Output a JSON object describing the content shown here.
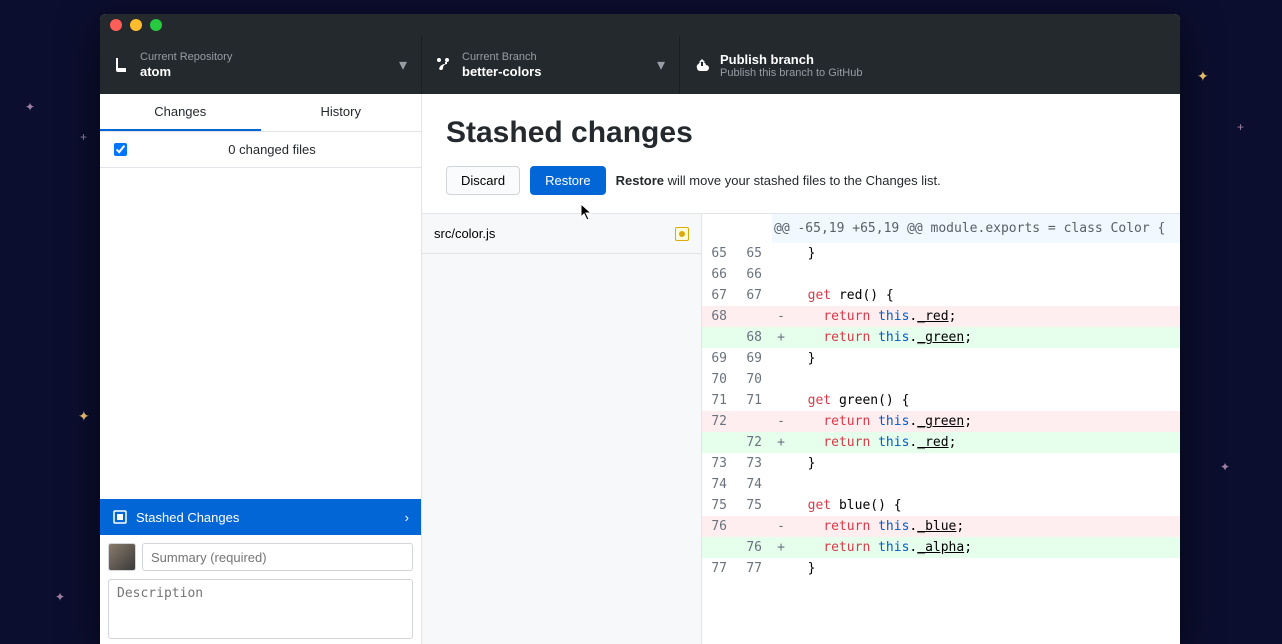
{
  "window": {
    "repo_label": "Current Repository",
    "repo_value": "atom",
    "branch_label": "Current Branch",
    "branch_value": "better-colors",
    "publish_title": "Publish branch",
    "publish_sub": "Publish this branch to GitHub"
  },
  "sidebar": {
    "tabs": {
      "changes": "Changes",
      "history": "History"
    },
    "changes_count": "0 changed files",
    "stashed_label": "Stashed Changes",
    "summary_placeholder": "Summary (required)",
    "description_placeholder": "Description"
  },
  "content": {
    "title": "Stashed changes",
    "discard": "Discard",
    "restore": "Restore",
    "hint_bold": "Restore",
    "hint_rest": " will move your stashed files to the Changes list.",
    "file": "src/color.js",
    "hunk_header": "@@ -65,19 +65,19 @@ module.exports = class Color {"
  },
  "diff": [
    {
      "old": "65",
      "new": "65",
      "type": "ctx",
      "marker": " ",
      "text": "  }"
    },
    {
      "old": "66",
      "new": "66",
      "type": "ctx",
      "marker": " ",
      "text": ""
    },
    {
      "old": "67",
      "new": "67",
      "type": "ctx",
      "marker": " ",
      "text": "  get red() {"
    },
    {
      "old": "68",
      "new": "",
      "type": "del",
      "marker": "-",
      "text": "    return this._red;",
      "uword": "red"
    },
    {
      "old": "",
      "new": "68",
      "type": "add",
      "marker": "+",
      "text": "    return this._green;",
      "uword": "green"
    },
    {
      "old": "69",
      "new": "69",
      "type": "ctx",
      "marker": " ",
      "text": "  }"
    },
    {
      "old": "70",
      "new": "70",
      "type": "ctx",
      "marker": " ",
      "text": ""
    },
    {
      "old": "71",
      "new": "71",
      "type": "ctx",
      "marker": " ",
      "text": "  get green() {"
    },
    {
      "old": "72",
      "new": "",
      "type": "del",
      "marker": "-",
      "text": "    return this._green;",
      "uword": "green"
    },
    {
      "old": "",
      "new": "72",
      "type": "add",
      "marker": "+",
      "text": "    return this._red;",
      "uword": "red"
    },
    {
      "old": "73",
      "new": "73",
      "type": "ctx",
      "marker": " ",
      "text": "  }"
    },
    {
      "old": "74",
      "new": "74",
      "type": "ctx",
      "marker": " ",
      "text": ""
    },
    {
      "old": "75",
      "new": "75",
      "type": "ctx",
      "marker": " ",
      "text": "  get blue() {"
    },
    {
      "old": "76",
      "new": "",
      "type": "del",
      "marker": "-",
      "text": "    return this._blue;",
      "uword": "blue"
    },
    {
      "old": "",
      "new": "76",
      "type": "add",
      "marker": "+",
      "text": "    return this._alpha;",
      "uword": "alpha"
    },
    {
      "old": "77",
      "new": "77",
      "type": "ctx",
      "marker": " ",
      "text": "  }"
    }
  ]
}
